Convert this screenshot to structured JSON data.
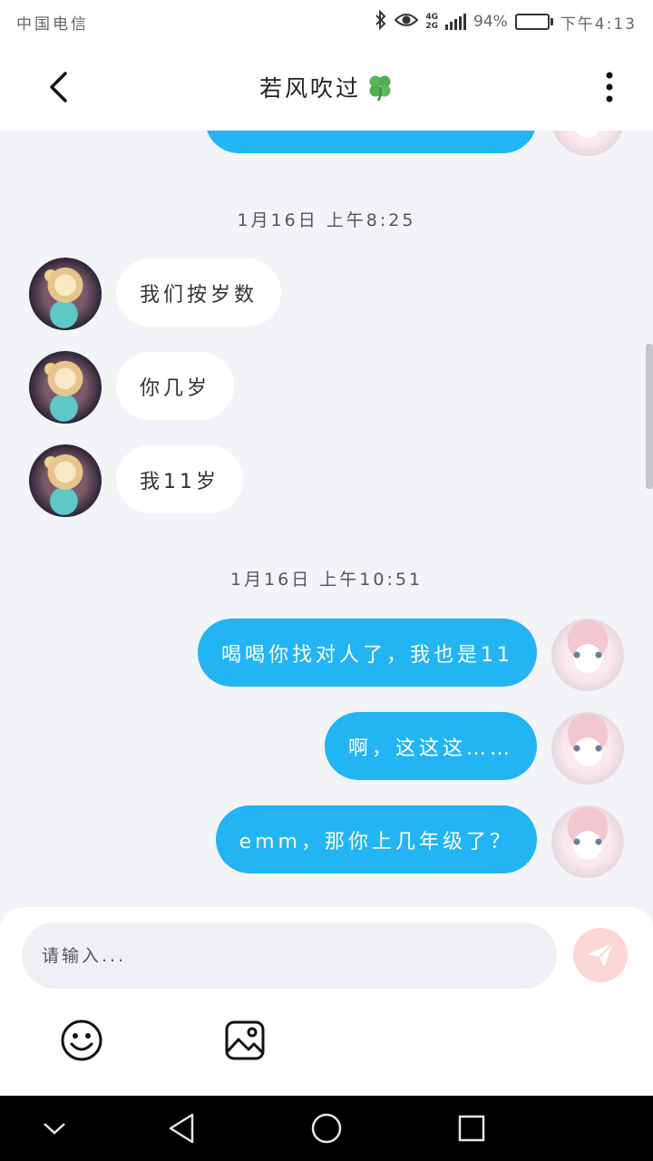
{
  "status_bar": {
    "carrier": "中国电信",
    "network_top": "4G",
    "network_bottom": "2G",
    "battery_percent": "94%",
    "battery_level": 0.94,
    "time": "下午4:13"
  },
  "header": {
    "title": "若风吹过"
  },
  "messages": [
    {
      "time": "1月16日 上午8:25"
    },
    {
      "from": "other",
      "text": "我们按岁数"
    },
    {
      "from": "other",
      "text": "你几岁"
    },
    {
      "from": "other",
      "text": "我11岁"
    },
    {
      "time": "1月16日 上午10:51"
    },
    {
      "from": "me",
      "text": "喝喝你找对人了，我也是11"
    },
    {
      "from": "me",
      "text": "啊，这这这……"
    },
    {
      "from": "me",
      "text": "emm，那你上几年级了？"
    }
  ],
  "input": {
    "placeholder": "请输入...",
    "value": ""
  },
  "icons": {
    "back": "chevron-left-icon",
    "more": "more-vertical-icon",
    "send": "paper-plane-icon",
    "emoji": "smiley-icon",
    "image": "image-icon",
    "clover": "clover-icon"
  },
  "colors": {
    "outgoing_bubble": "#23b4f3",
    "incoming_bubble": "#ffffff",
    "background": "#f3f4f8",
    "send_button": "#fcd8d4"
  }
}
